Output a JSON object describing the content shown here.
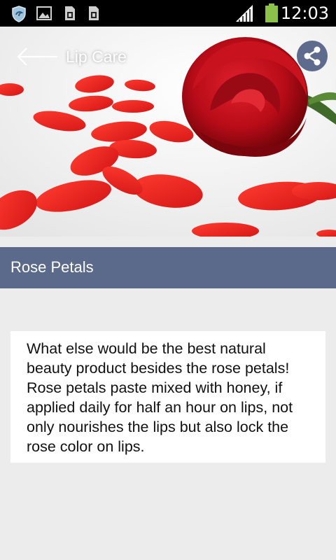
{
  "status_bar": {
    "time": "12:03",
    "icons": [
      "shield-icon",
      "image-icon",
      "sim-card-icon",
      "sim-card-icon",
      "signal-icon",
      "battery-icon"
    ]
  },
  "header": {
    "title": "Lip Care",
    "back_icon": "arrow-left-icon",
    "share_icon": "share-icon",
    "image": "rose-and-petals"
  },
  "article": {
    "title": "Rose Petals",
    "body": "What else would be the best natural beauty product besides the rose petals! Rose petals paste mixed with honey, if applied daily for half an hour on lips, not only nourishes the lips but also lock the rose color on lips."
  },
  "colors": {
    "title_bar": "#5b6a8a",
    "share_button": "#5f6b8c",
    "background": "#ececec",
    "battery": "#8bc34a"
  }
}
